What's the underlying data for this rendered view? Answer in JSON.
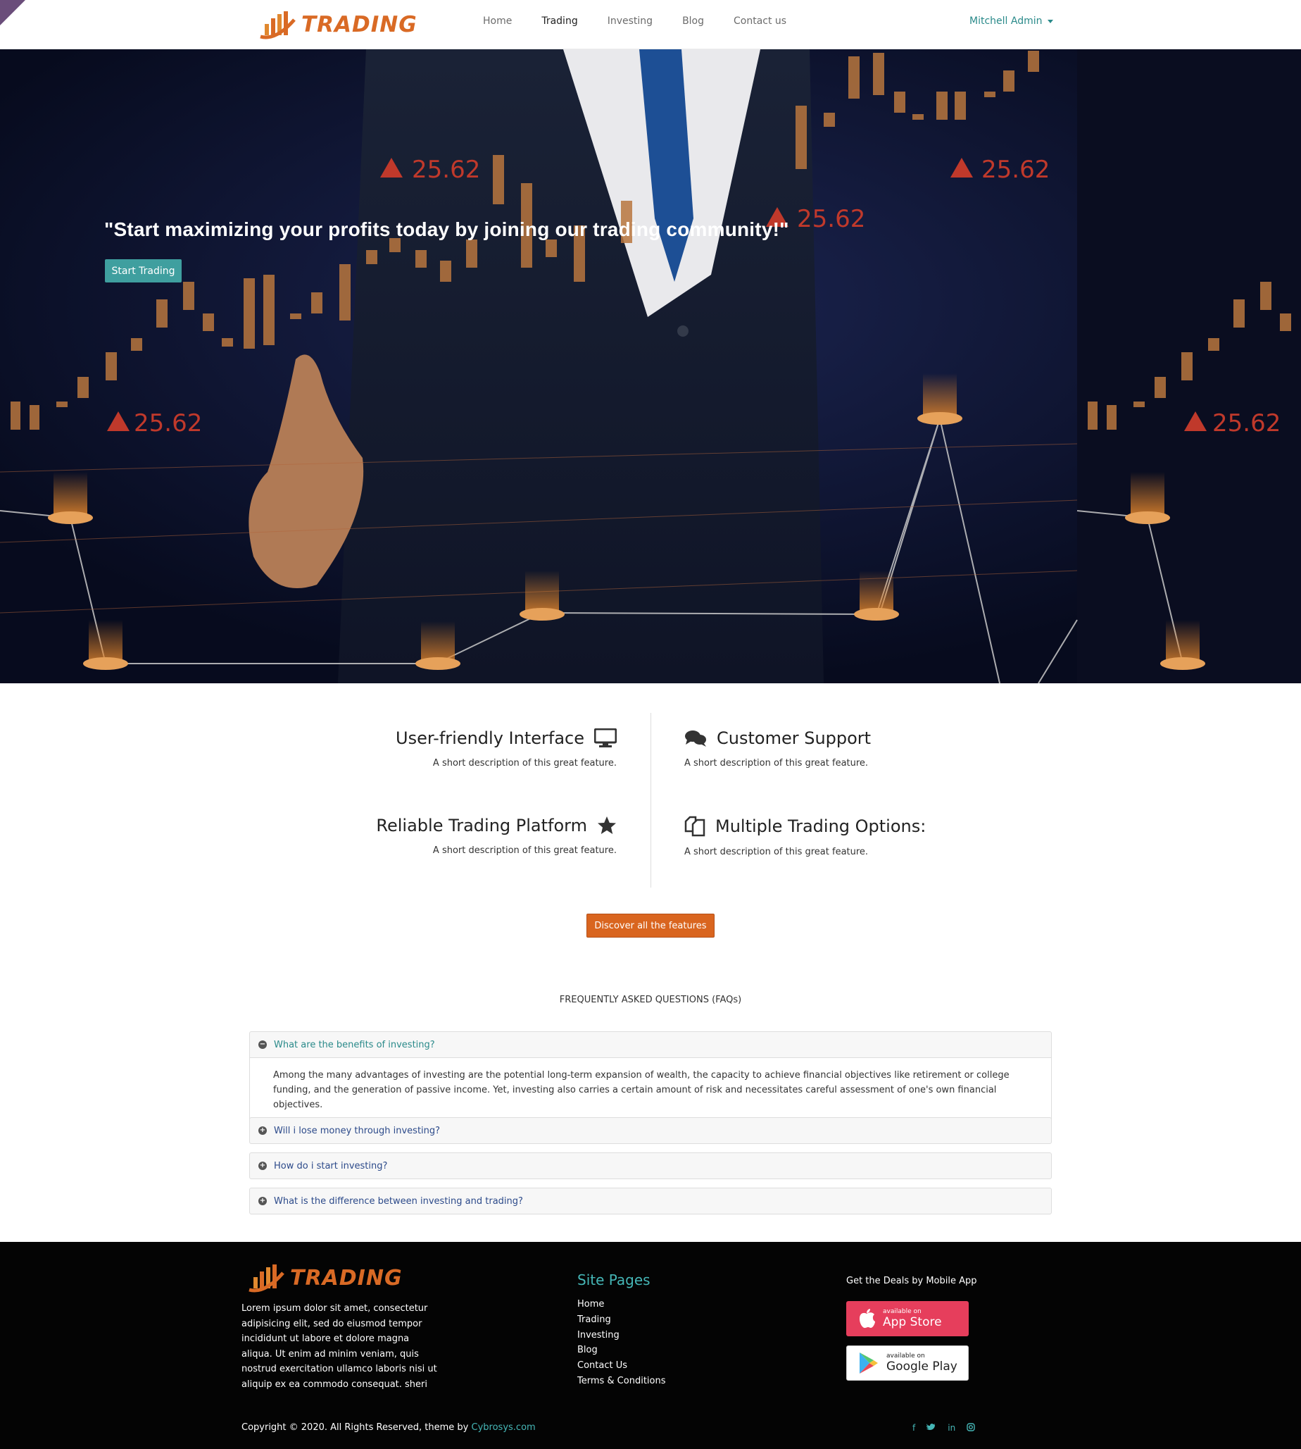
{
  "brand": {
    "name": "TRADING",
    "accent": "#d96a25",
    "teal": "#3f9f9f"
  },
  "nav": {
    "items": [
      "Home",
      "Trading",
      "Investing",
      "Blog",
      "Contact us"
    ],
    "active": "Trading",
    "user": "Mitchell Admin"
  },
  "hero": {
    "quote": "\"Start maximizing your profits today by joining our trading community!\"",
    "cta": "Start Trading",
    "price_tag": "25.62"
  },
  "features": [
    {
      "title": "User-friendly Interface",
      "desc": "A short description of this great feature.",
      "icon": "monitor-icon"
    },
    {
      "title": "Customer Support",
      "desc": "A short description of this great feature.",
      "icon": "comments-icon"
    },
    {
      "title": "Reliable Trading Platform",
      "desc": "A short description of this great feature.",
      "icon": "star-icon"
    },
    {
      "title": "Multiple Trading Options:",
      "desc": "A short description of this great feature.",
      "icon": "copy-icon"
    }
  ],
  "discover_label": "Discover all the features",
  "faq": {
    "title": "FREQUENTLY ASKED QUESTIONS (FAQs)",
    "items": [
      {
        "q": "What are the benefits of investing?",
        "open": true,
        "a": "Among the many advantages of investing are the potential long-term expansion of wealth, the capacity to achieve financial objectives like retirement or college funding, and the generation of passive income. Yet, investing also carries a certain amount of risk and necessitates careful assessment of one's own financial objectives."
      },
      {
        "q": "Will i lose money through investing?",
        "open": false
      },
      {
        "q": "How do i start investing?",
        "open": false
      },
      {
        "q": "What is the difference between investing and trading?",
        "open": false
      }
    ]
  },
  "footer": {
    "desc": "Lorem ipsum dolor sit amet, consectetur adipisicing elit, sed do eiusmod tempor incididunt ut labore et dolore magna aliqua. Ut enim ad minim veniam, quis nostrud exercitation ullamco laboris nisi ut aliquip ex ea commodo consequat. sheri",
    "site_pages_title": "Site Pages",
    "site_pages": [
      "Home",
      "Trading",
      "Investing",
      "Blog",
      "Contact Us",
      "Terms & Conditions"
    ],
    "deals_title": "Get the Deals by Mobile App",
    "app_store": {
      "small": "available on",
      "big": "App Store"
    },
    "google_play": {
      "small": "available on",
      "big": "Google Play"
    },
    "copyright": "Copyright © 2020. All Rights Reserved, theme by",
    "credit": "Cybrosys.com",
    "social": [
      "facebook-icon",
      "twitter-icon",
      "linkedin-icon",
      "instagram-icon"
    ]
  }
}
